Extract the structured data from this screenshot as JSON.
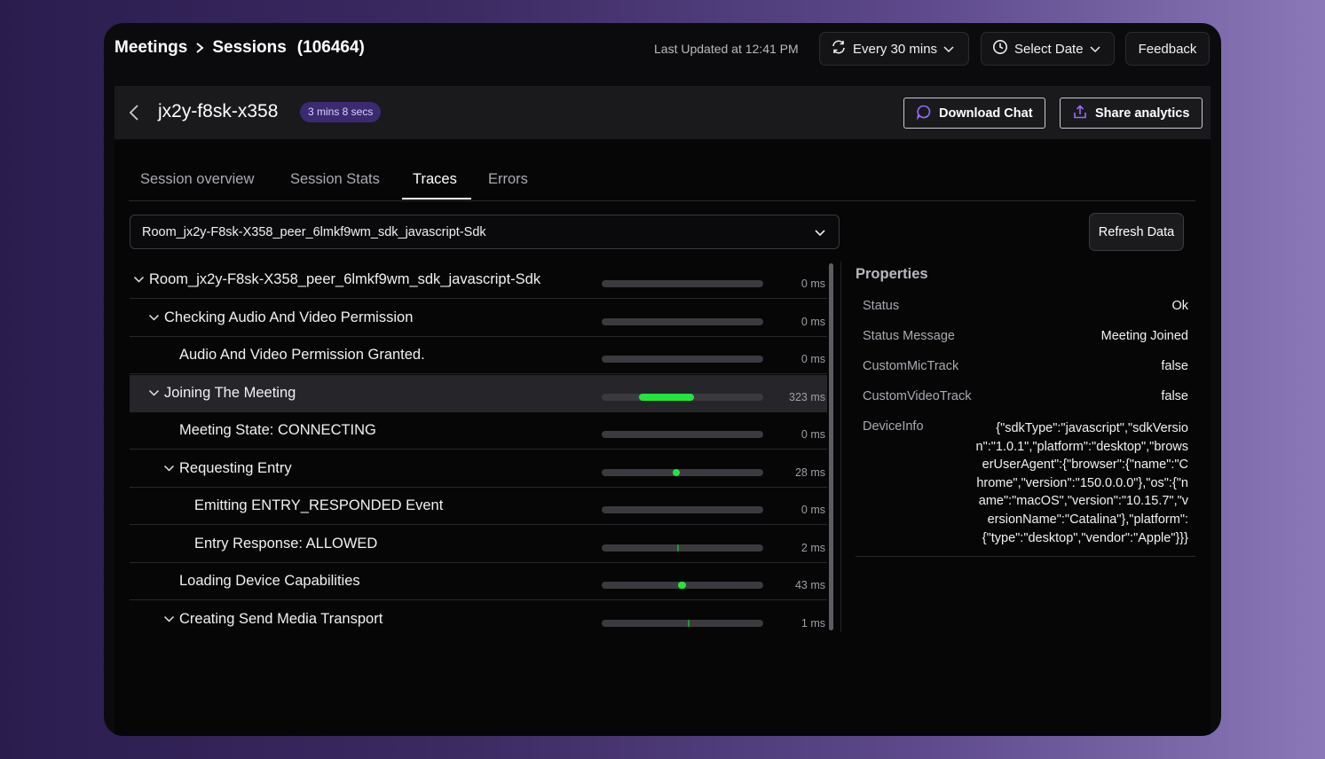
{
  "breadcrumb": {
    "root": "Meetings",
    "current": "Sessions",
    "count": "(106464)"
  },
  "toolbar": {
    "last_updated": "Last Updated at 12:41 PM",
    "refresh_interval": "Every 30 mins",
    "date_picker": "Select Date",
    "feedback": "Feedback"
  },
  "session": {
    "id": "jx2y-f8sk-x358",
    "duration": "3 mins 8 secs",
    "download_chat": "Download Chat",
    "share_analytics": "Share analytics"
  },
  "tabs": [
    {
      "label": "Session overview",
      "active": false
    },
    {
      "label": "Session Stats",
      "active": false
    },
    {
      "label": "Traces",
      "active": true
    },
    {
      "label": "Errors",
      "active": false
    }
  ],
  "peer_select": {
    "value": "Room_jx2y-F8sk-X358_peer_6lmkf9wm_sdk_javascript-Sdk"
  },
  "refresh_button": "Refresh Data",
  "traces": [
    {
      "label": "Room_jx2y-F8sk-X358_peer_6lmkf9wm_sdk_javascript-Sdk",
      "duration": "0 ms",
      "level": 0,
      "expandable": true,
      "start": 0,
      "span": 0
    },
    {
      "label": "Checking Audio And Video Permission",
      "duration": "0 ms",
      "level": 1,
      "expandable": true,
      "start": 0,
      "span": 0
    },
    {
      "label": "Audio And Video Permission Granted.",
      "duration": "0 ms",
      "level": 2,
      "expandable": false,
      "start": 0,
      "span": 0
    },
    {
      "label": "Joining The Meeting",
      "duration": "323 ms",
      "level": 1,
      "expandable": true,
      "start": 0.23,
      "span": 0.34,
      "highlighted": true
    },
    {
      "label": "Meeting State: CONNECTING",
      "duration": "0 ms",
      "level": 2,
      "expandable": false,
      "start": 0,
      "span": 0
    },
    {
      "label": "Requesting Entry",
      "duration": "28 ms",
      "level": 2,
      "expandable": true,
      "start": 0.44,
      "span": 0.03
    },
    {
      "label": "Emitting ENTRY_RESPONDED Event",
      "duration": "0 ms",
      "level": 3,
      "expandable": false,
      "start": 0,
      "span": 0
    },
    {
      "label": "Entry Response: ALLOWED",
      "duration": "2 ms",
      "level": 3,
      "expandable": false,
      "start": 0.465,
      "span": 0.006
    },
    {
      "label": "Loading Device Capabilities",
      "duration": "43 ms",
      "level": 2,
      "expandable": false,
      "start": 0.47,
      "span": 0.05
    },
    {
      "label": "Creating Send Media Transport",
      "duration": "1 ms",
      "level": 2,
      "expandable": true,
      "start": 0.535,
      "span": 0.006
    }
  ],
  "properties": {
    "title": "Properties",
    "items": [
      {
        "key": "Status",
        "value": "Ok"
      },
      {
        "key": "Status Message",
        "value": "Meeting Joined"
      },
      {
        "key": "CustomMicTrack",
        "value": "false"
      },
      {
        "key": "CustomVideoTrack",
        "value": "false"
      },
      {
        "key": "DeviceInfo",
        "value": "{\"sdkType\":\"javascript\",\"sdkVersion\":\"1.0.1\",\"platform\":\"desktop\",\"browserUserAgent\":{\"browser\":{\"name\":\"Chrome\",\"version\":\"150.0.0.0\"},\"os\":{\"name\":\"macOS\",\"version\":\"10.15.7\",\"versionName\":\"Catalina\"},\"platform\":{\"type\":\"desktop\",\"vendor\":\"Apple\"}}}"
      }
    ]
  },
  "icons": [
    "chevron-right-icon",
    "refresh-icon",
    "clock-icon",
    "chevron-down-icon",
    "back-arrow-icon",
    "chat-bubble-icon",
    "share-upload-icon"
  ],
  "colors": {
    "accent": "#22e63a",
    "badge": "#3b2a72",
    "panel": "#060607"
  }
}
